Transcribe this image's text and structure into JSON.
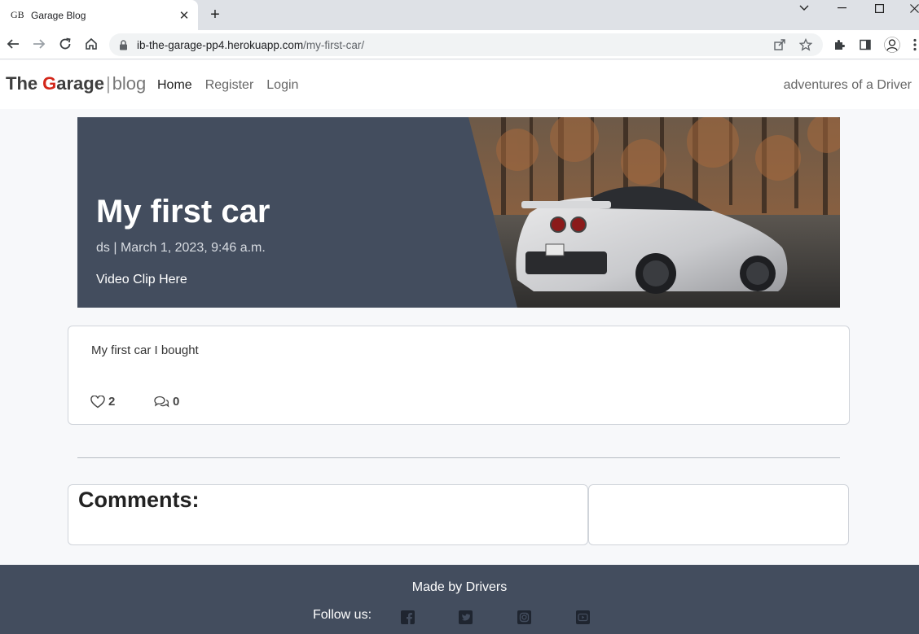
{
  "browser": {
    "tab_favicon": "GB",
    "tab_title": "Garage Blog",
    "url_host": "ib-the-garage-pp4.herokuapp.com",
    "url_path": "/my-first-car/"
  },
  "navbar": {
    "brand_the": "The",
    "brand_g": "G",
    "brand_arage": "arage",
    "brand_bar": "|",
    "brand_blog": "blog",
    "links": [
      {
        "label": "Home"
      },
      {
        "label": "Register"
      },
      {
        "label": "Login"
      }
    ],
    "tagline": "adventures of a Driver"
  },
  "hero": {
    "title": "My first car",
    "meta": "ds | March 1, 2023, 9:46 a.m.",
    "video_link": "Video Clip Here"
  },
  "post": {
    "body": "My first car I bought",
    "likes": "2",
    "comments_count": "0"
  },
  "comments": {
    "title": "Comments:"
  },
  "footer": {
    "made_by": "Made by Drivers",
    "follow": "Follow us:",
    "social": [
      "facebook-icon",
      "twitter-icon",
      "instagram-icon",
      "youtube-icon"
    ]
  },
  "colors": {
    "brand_accent": "#d3271a",
    "hero_bg": "#434d5e",
    "footer_bg": "#434d5e"
  }
}
